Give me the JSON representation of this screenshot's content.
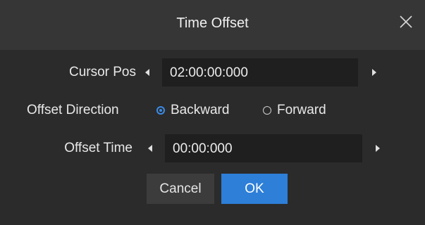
{
  "dialog": {
    "title": "Time Offset",
    "close_icon": "close-icon"
  },
  "cursor_pos": {
    "label": "Cursor Pos",
    "value": "02:00:00:000",
    "left_arrow_icon": "caret-left-icon",
    "right_arrow_icon": "caret-right-icon"
  },
  "offset_direction": {
    "label": "Offset Direction",
    "options": [
      {
        "label": "Backward",
        "selected": true
      },
      {
        "label": "Forward",
        "selected": false
      }
    ]
  },
  "offset_time": {
    "label": "Offset Time",
    "value": "00:00:000",
    "left_arrow_icon": "caret-left-icon",
    "right_arrow_icon": "caret-right-icon"
  },
  "buttons": {
    "cancel_label": "Cancel",
    "ok_label": "OK"
  },
  "colors": {
    "accent": "#2d7fd8",
    "background": "#2b2b2b",
    "titlebar": "#363636",
    "field": "#1f1f1f"
  }
}
